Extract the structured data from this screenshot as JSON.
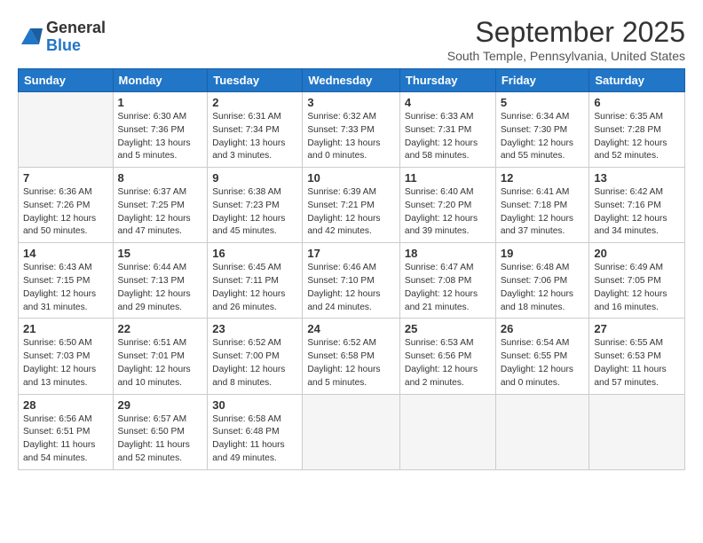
{
  "logo": {
    "general": "General",
    "blue": "Blue"
  },
  "title": "September 2025",
  "subtitle": "South Temple, Pennsylvania, United States",
  "days_header": [
    "Sunday",
    "Monday",
    "Tuesday",
    "Wednesday",
    "Thursday",
    "Friday",
    "Saturday"
  ],
  "weeks": [
    [
      {
        "num": "",
        "info": ""
      },
      {
        "num": "1",
        "info": "Sunrise: 6:30 AM\nSunset: 7:36 PM\nDaylight: 13 hours\nand 5 minutes."
      },
      {
        "num": "2",
        "info": "Sunrise: 6:31 AM\nSunset: 7:34 PM\nDaylight: 13 hours\nand 3 minutes."
      },
      {
        "num": "3",
        "info": "Sunrise: 6:32 AM\nSunset: 7:33 PM\nDaylight: 13 hours\nand 0 minutes."
      },
      {
        "num": "4",
        "info": "Sunrise: 6:33 AM\nSunset: 7:31 PM\nDaylight: 12 hours\nand 58 minutes."
      },
      {
        "num": "5",
        "info": "Sunrise: 6:34 AM\nSunset: 7:30 PM\nDaylight: 12 hours\nand 55 minutes."
      },
      {
        "num": "6",
        "info": "Sunrise: 6:35 AM\nSunset: 7:28 PM\nDaylight: 12 hours\nand 52 minutes."
      }
    ],
    [
      {
        "num": "7",
        "info": "Sunrise: 6:36 AM\nSunset: 7:26 PM\nDaylight: 12 hours\nand 50 minutes."
      },
      {
        "num": "8",
        "info": "Sunrise: 6:37 AM\nSunset: 7:25 PM\nDaylight: 12 hours\nand 47 minutes."
      },
      {
        "num": "9",
        "info": "Sunrise: 6:38 AM\nSunset: 7:23 PM\nDaylight: 12 hours\nand 45 minutes."
      },
      {
        "num": "10",
        "info": "Sunrise: 6:39 AM\nSunset: 7:21 PM\nDaylight: 12 hours\nand 42 minutes."
      },
      {
        "num": "11",
        "info": "Sunrise: 6:40 AM\nSunset: 7:20 PM\nDaylight: 12 hours\nand 39 minutes."
      },
      {
        "num": "12",
        "info": "Sunrise: 6:41 AM\nSunset: 7:18 PM\nDaylight: 12 hours\nand 37 minutes."
      },
      {
        "num": "13",
        "info": "Sunrise: 6:42 AM\nSunset: 7:16 PM\nDaylight: 12 hours\nand 34 minutes."
      }
    ],
    [
      {
        "num": "14",
        "info": "Sunrise: 6:43 AM\nSunset: 7:15 PM\nDaylight: 12 hours\nand 31 minutes."
      },
      {
        "num": "15",
        "info": "Sunrise: 6:44 AM\nSunset: 7:13 PM\nDaylight: 12 hours\nand 29 minutes."
      },
      {
        "num": "16",
        "info": "Sunrise: 6:45 AM\nSunset: 7:11 PM\nDaylight: 12 hours\nand 26 minutes."
      },
      {
        "num": "17",
        "info": "Sunrise: 6:46 AM\nSunset: 7:10 PM\nDaylight: 12 hours\nand 24 minutes."
      },
      {
        "num": "18",
        "info": "Sunrise: 6:47 AM\nSunset: 7:08 PM\nDaylight: 12 hours\nand 21 minutes."
      },
      {
        "num": "19",
        "info": "Sunrise: 6:48 AM\nSunset: 7:06 PM\nDaylight: 12 hours\nand 18 minutes."
      },
      {
        "num": "20",
        "info": "Sunrise: 6:49 AM\nSunset: 7:05 PM\nDaylight: 12 hours\nand 16 minutes."
      }
    ],
    [
      {
        "num": "21",
        "info": "Sunrise: 6:50 AM\nSunset: 7:03 PM\nDaylight: 12 hours\nand 13 minutes."
      },
      {
        "num": "22",
        "info": "Sunrise: 6:51 AM\nSunset: 7:01 PM\nDaylight: 12 hours\nand 10 minutes."
      },
      {
        "num": "23",
        "info": "Sunrise: 6:52 AM\nSunset: 7:00 PM\nDaylight: 12 hours\nand 8 minutes."
      },
      {
        "num": "24",
        "info": "Sunrise: 6:52 AM\nSunset: 6:58 PM\nDaylight: 12 hours\nand 5 minutes."
      },
      {
        "num": "25",
        "info": "Sunrise: 6:53 AM\nSunset: 6:56 PM\nDaylight: 12 hours\nand 2 minutes."
      },
      {
        "num": "26",
        "info": "Sunrise: 6:54 AM\nSunset: 6:55 PM\nDaylight: 12 hours\nand 0 minutes."
      },
      {
        "num": "27",
        "info": "Sunrise: 6:55 AM\nSunset: 6:53 PM\nDaylight: 11 hours\nand 57 minutes."
      }
    ],
    [
      {
        "num": "28",
        "info": "Sunrise: 6:56 AM\nSunset: 6:51 PM\nDaylight: 11 hours\nand 54 minutes."
      },
      {
        "num": "29",
        "info": "Sunrise: 6:57 AM\nSunset: 6:50 PM\nDaylight: 11 hours\nand 52 minutes."
      },
      {
        "num": "30",
        "info": "Sunrise: 6:58 AM\nSunset: 6:48 PM\nDaylight: 11 hours\nand 49 minutes."
      },
      {
        "num": "",
        "info": ""
      },
      {
        "num": "",
        "info": ""
      },
      {
        "num": "",
        "info": ""
      },
      {
        "num": "",
        "info": ""
      }
    ]
  ]
}
